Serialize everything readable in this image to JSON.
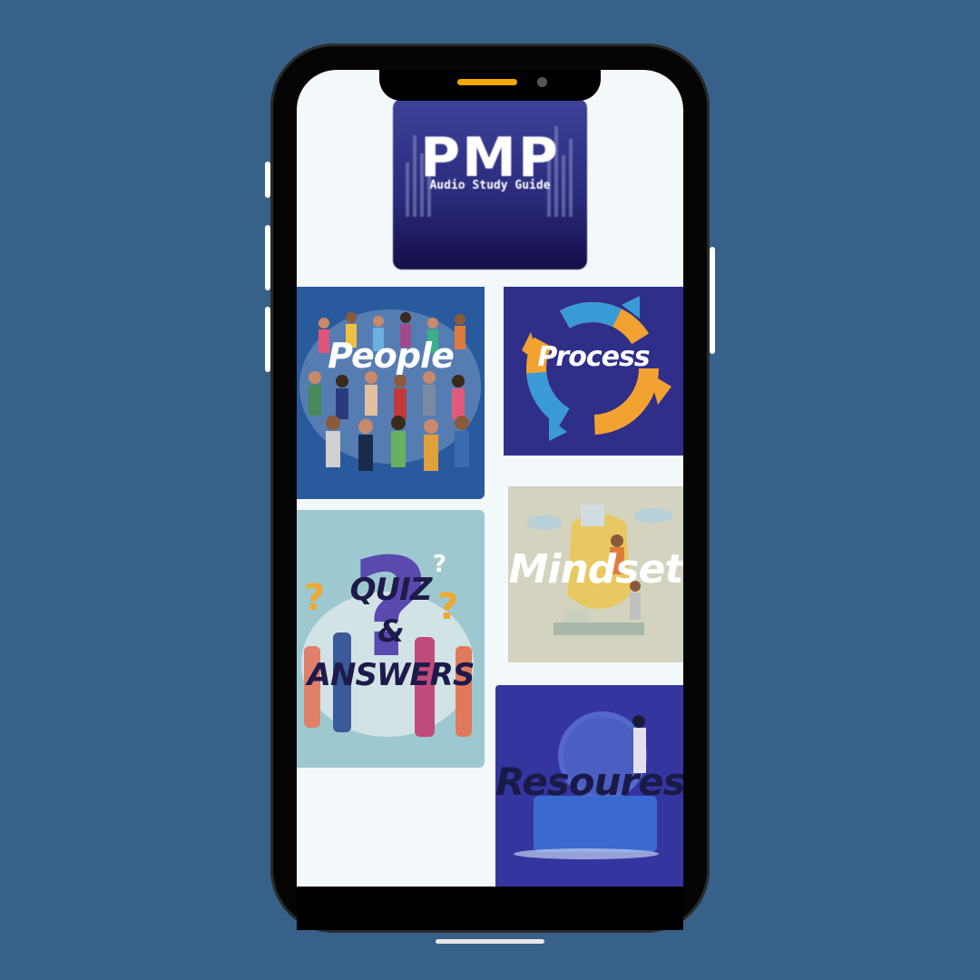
{
  "app": {
    "logo_title": "PMP",
    "logo_subtitle": "Audio Study Guide"
  },
  "tiles": [
    {
      "id": "people",
      "label": "People"
    },
    {
      "id": "process",
      "label": "Process"
    },
    {
      "id": "quiz",
      "label_lines": [
        "QUIZ",
        "&",
        "ANSWERS"
      ]
    },
    {
      "id": "mindset",
      "label": "Mindset"
    },
    {
      "id": "resources",
      "label": "Resoures"
    }
  ],
  "colors": {
    "background": "#386189",
    "speaker": "#f0a800",
    "logo_bg": "#2a2a7a",
    "people_bg": "#2a5a9e",
    "process_bg": "#2f2f8a",
    "quiz_bg": "#9ec8cf",
    "mindset_bg": "#d3d3bf",
    "resources_bg": "#3535a0"
  },
  "icons": [
    "pmp-logo-icon",
    "people-crowd-icon",
    "cycle-arrows-icon",
    "question-marks-icon",
    "puzzle-head-icon",
    "magnifier-icon"
  ]
}
